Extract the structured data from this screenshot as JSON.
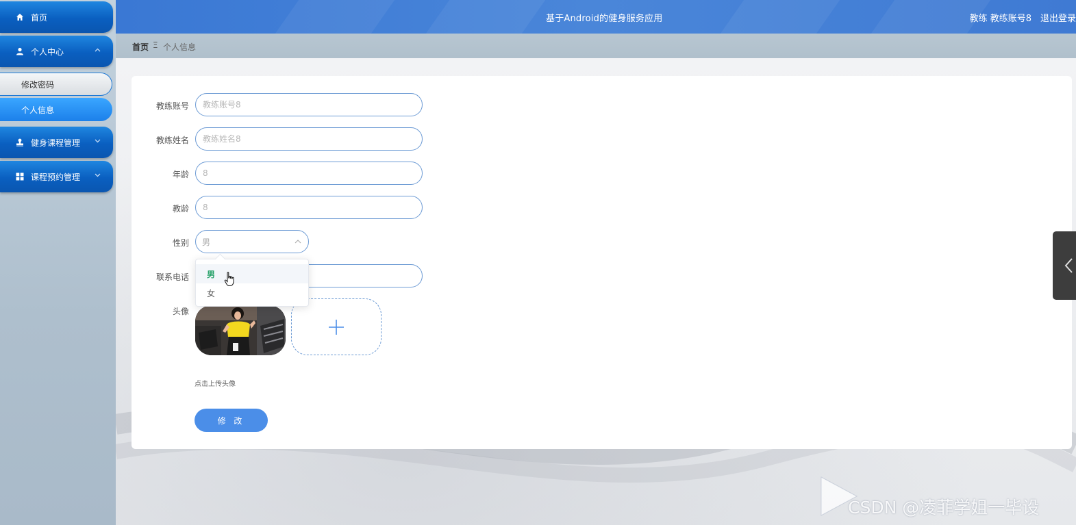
{
  "sidebar": {
    "home": "首页",
    "personal_center": "个人中心",
    "change_password": "修改密码",
    "personal_info": "个人信息",
    "course_management": "健身课程管理",
    "booking_management": "课程预约管理"
  },
  "header": {
    "title": "基于Android的健身服务应用",
    "user": "教练 教练账号8",
    "logout": "退出登录"
  },
  "breadcrumb": {
    "home": "首页",
    "separator": "Ξ",
    "current": "个人信息"
  },
  "form": {
    "account": {
      "label": "教练账号",
      "placeholder": "教练账号8"
    },
    "name": {
      "label": "教练姓名",
      "placeholder": "教练姓名8"
    },
    "age": {
      "label": "年龄",
      "placeholder": "8"
    },
    "teaching_years": {
      "label": "教龄",
      "placeholder": "8"
    },
    "gender": {
      "label": "性别",
      "value": "男",
      "options": [
        "男",
        "女"
      ]
    },
    "phone": {
      "label": "联系电话",
      "placeholder": ""
    },
    "avatar": {
      "label": "头像",
      "upload_tip": "点击上传头像"
    },
    "submit": "修 改"
  },
  "watermark": "CSDN @凌菲学姐一毕设",
  "colors": {
    "primary": "#3a78d4",
    "sidebar_button": "#0a5fc0",
    "input_border": "#6b9ad4",
    "selected_option": "#2aa36b",
    "submit": "#4b8ee8"
  }
}
